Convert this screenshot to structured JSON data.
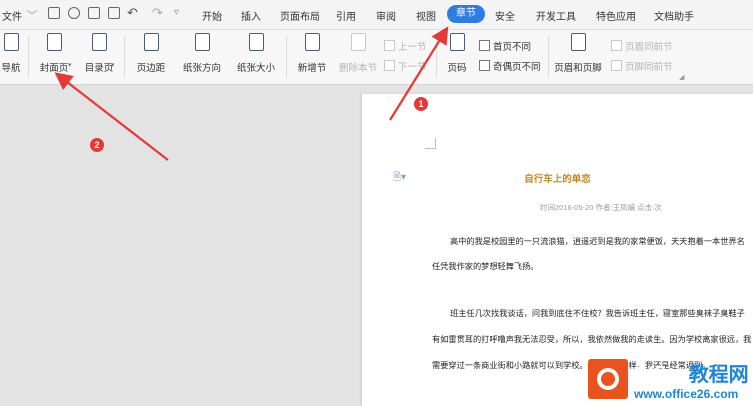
{
  "menubar": {
    "file_label": "文件",
    "tabs": [
      {
        "label": "开始"
      },
      {
        "label": "插入"
      },
      {
        "label": "页面布局"
      },
      {
        "label": "引用"
      },
      {
        "label": "审阅"
      },
      {
        "label": "视图"
      },
      {
        "label": "章节"
      },
      {
        "label": "安全"
      },
      {
        "label": "开发工具"
      },
      {
        "label": "特色应用"
      },
      {
        "label": "文档助手"
      }
    ],
    "active_tab": "章节"
  },
  "ribbon": {
    "nav_pane": "导航",
    "cover": "封面页",
    "toc": "目录页",
    "margins": "页边距",
    "orientation": "纸张方向",
    "size": "纸张大小",
    "add_section": "新增节",
    "delete_section": "删除本节",
    "prev_section": "上一节",
    "next_section": "下一节",
    "page_number": "页码",
    "first_page_different": "首页不同",
    "odd_even_different": "奇偶页不同",
    "header_footer": "页眉和页脚",
    "same_header_prev": "页眉同前节",
    "same_footer_prev": "页脚同前节"
  },
  "document": {
    "title": "自行车上的单恋",
    "meta": "时间2016-05-20  作者:王凤编  点击:次",
    "paragraphs": [
      "高中的我是校园里的一只流浪猫，逍遥迟到是我的家常便饭，天天抱着一本世界名",
      "任凭我作家的梦想轻舞飞扬。",
      "班主任几次找我谈话，问我到底住不住校？我告诉班主任，寝室那些臭袜子臭鞋子",
      "有如雷贯耳的打呼噜声我无法忍受，所以，我依然做我的走读生。因为学校离家很远，我",
      "需要穿过一条商业街和小路就可以到学校。天天都是这样，我还是经常迟到。"
    ]
  },
  "annotations": {
    "badge1": "1",
    "badge2": "2",
    "color": "#e53935"
  },
  "watermark": {
    "brand_main": "Office",
    "brand_cn": "教程网",
    "url": "www.office26.com"
  }
}
